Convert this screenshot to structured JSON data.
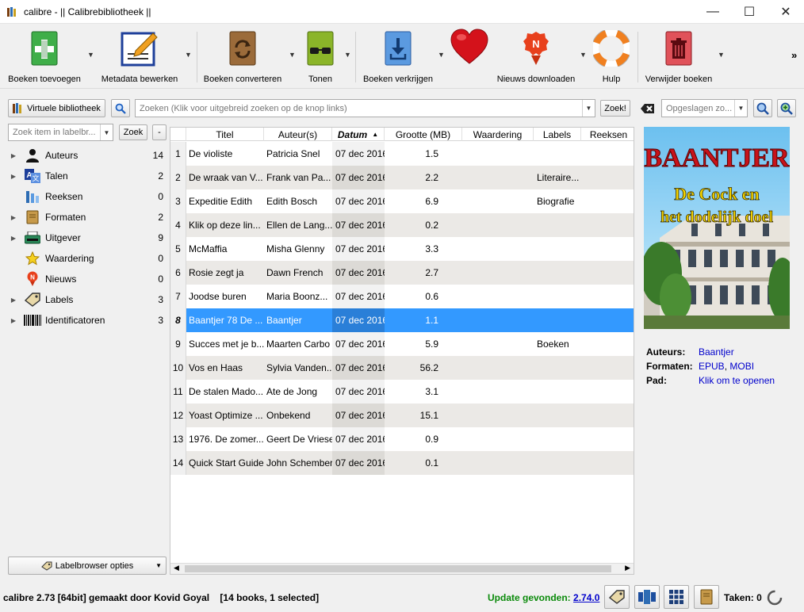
{
  "window": {
    "title": "calibre - || Calibrebibliotheek ||",
    "minimize": "—",
    "maximize": "☐",
    "close": "✕"
  },
  "toolbar": {
    "items": [
      {
        "label": "Boeken toevoegen"
      },
      {
        "label": "Metadata bewerken"
      },
      {
        "label": "Boeken converteren"
      },
      {
        "label": "Tonen"
      },
      {
        "label": "Boeken verkrijgen"
      },
      {
        "label": "Nieuws downloaden"
      },
      {
        "label": "Hulp"
      },
      {
        "label": "Verwijder boeken"
      }
    ],
    "overflow": "»"
  },
  "search": {
    "virtual_library": "Virtuele bibliotheek",
    "placeholder": "Zoeken (Klik voor uitgebreid zoeken op de knop links)",
    "go": "Zoek!",
    "saved_placeholder": "Opgeslagen zo..."
  },
  "tagbrowser": {
    "filter_placeholder": "Zoek item in labelbr...",
    "find": "Zoek",
    "collapse": "-",
    "items": [
      {
        "label": "Auteurs",
        "count": "14"
      },
      {
        "label": "Talen",
        "count": "2"
      },
      {
        "label": "Reeksen",
        "count": "0"
      },
      {
        "label": "Formaten",
        "count": "2"
      },
      {
        "label": "Uitgever",
        "count": "9"
      },
      {
        "label": "Waardering",
        "count": "0"
      },
      {
        "label": "Nieuws",
        "count": "0"
      },
      {
        "label": "Labels",
        "count": "3"
      },
      {
        "label": "Identificatoren",
        "count": "3"
      }
    ],
    "options": "Labelbrowser opties"
  },
  "table": {
    "columns": [
      "Titel",
      "Auteur(s)",
      "Datum",
      "Grootte (MB)",
      "Waardering",
      "Labels",
      "Reeksen"
    ],
    "rows": [
      {
        "n": "1",
        "title": "De violiste",
        "author": "Patricia Snel",
        "date": "07 dec 2016",
        "size": "1.5",
        "labels": ""
      },
      {
        "n": "2",
        "title": "De wraak van V...",
        "author": "Frank van Pa...",
        "date": "07 dec 2016",
        "size": "2.2",
        "labels": "Literaire..."
      },
      {
        "n": "3",
        "title": "Expeditie Edith",
        "author": "Edith Bosch",
        "date": "07 dec 2016",
        "size": "6.9",
        "labels": "Biografie"
      },
      {
        "n": "4",
        "title": "Klik op deze lin...",
        "author": "Ellen de Lang...",
        "date": "07 dec 2016",
        "size": "0.2",
        "labels": ""
      },
      {
        "n": "5",
        "title": "McMaffia",
        "author": "Misha Glenny",
        "date": "07 dec 2016",
        "size": "3.3",
        "labels": ""
      },
      {
        "n": "6",
        "title": "Rosie zegt ja",
        "author": "Dawn French",
        "date": "07 dec 2016",
        "size": "2.7",
        "labels": ""
      },
      {
        "n": "7",
        "title": "Joodse buren",
        "author": "Maria Boonz...",
        "date": "07 dec 2016",
        "size": "0.6",
        "labels": ""
      },
      {
        "n": "8",
        "title": "Baantjer 78 De ...",
        "author": "Baantjer",
        "date": "07 dec 2016",
        "size": "1.1",
        "labels": ""
      },
      {
        "n": "9",
        "title": "Succes met je b...",
        "author": "Maarten Carbo",
        "date": "07 dec 2016",
        "size": "5.9",
        "labels": "Boeken"
      },
      {
        "n": "10",
        "title": "Vos en Haas",
        "author": "Sylvia Vanden...",
        "date": "07 dec 2016",
        "size": "56.2",
        "labels": ""
      },
      {
        "n": "11",
        "title": "De stalen Mado...",
        "author": "Ate de Jong",
        "date": "07 dec 2016",
        "size": "3.1",
        "labels": ""
      },
      {
        "n": "12",
        "title": "Yoast Optimize ...",
        "author": "Onbekend",
        "date": "07 dec 2016",
        "size": "15.1",
        "labels": ""
      },
      {
        "n": "13",
        "title": "1976. De zomer...",
        "author": "Geert De Vriese",
        "date": "07 dec 2016",
        "size": "0.9",
        "labels": ""
      },
      {
        "n": "14",
        "title": "Quick Start Guide",
        "author": "John Schember",
        "date": "07 dec 2016",
        "size": "0.1",
        "labels": ""
      }
    ]
  },
  "cover": {
    "line1": "BAANTJER",
    "line2": "De Cock en",
    "line3": "het dodelijk doel"
  },
  "details": {
    "authors_label": "Auteurs:",
    "authors_value": "Baantjer",
    "formats_label": "Formaten:",
    "format1": "EPUB",
    "format2": "MOBI",
    "path_label": "Pad:",
    "path_value": "Klik om te openen"
  },
  "status": {
    "left": "calibre 2.73 [64bit] gemaakt door Kovid Goyal    [14 books, 1 selected]",
    "update_label": "Update gevonden:",
    "update_version": "2.74.0",
    "jobs": "Taken: 0"
  }
}
